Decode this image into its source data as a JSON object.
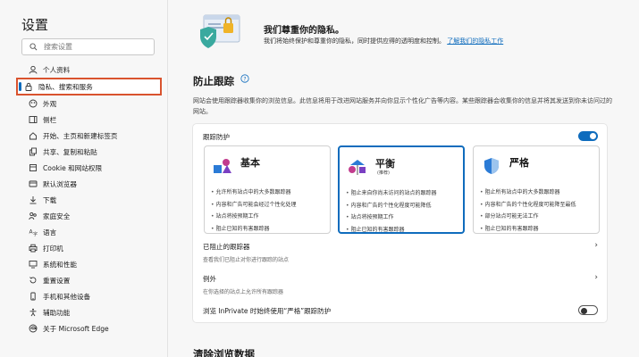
{
  "sidebar": {
    "title": "设置",
    "search_placeholder": "搜索设置",
    "items": [
      {
        "label": "个人资料",
        "icon": "profile-icon"
      },
      {
        "label": "隐私、搜索和服务",
        "icon": "lock-icon",
        "active": true
      },
      {
        "label": "外观",
        "icon": "appearance-icon"
      },
      {
        "label": "侧栏",
        "icon": "sidebar-icon"
      },
      {
        "label": "开始、主页和新建标签页",
        "icon": "home-icon"
      },
      {
        "label": "共享、复制和粘贴",
        "icon": "share-icon"
      },
      {
        "label": "Cookie 和网站权限",
        "icon": "cookie-icon"
      },
      {
        "label": "默认浏览器",
        "icon": "browser-icon"
      },
      {
        "label": "下载",
        "icon": "download-icon"
      },
      {
        "label": "家庭安全",
        "icon": "family-icon"
      },
      {
        "label": "语言",
        "icon": "language-icon"
      },
      {
        "label": "打印机",
        "icon": "printer-icon"
      },
      {
        "label": "系统和性能",
        "icon": "system-icon"
      },
      {
        "label": "重置设置",
        "icon": "reset-icon"
      },
      {
        "label": "手机和其他设备",
        "icon": "phone-icon"
      },
      {
        "label": "辅助功能",
        "icon": "accessibility-icon"
      },
      {
        "label": "关于 Microsoft Edge",
        "icon": "edge-icon"
      }
    ]
  },
  "banner": {
    "title": "我们尊重你的隐私。",
    "desc": "我们将始终保护和尊重你的隐私，同时提供应得的透明度和控制。",
    "link": "了解我们的隐私工作"
  },
  "tracking": {
    "title": "防止跟踪",
    "desc": "网站会使用跟踪器收集你的浏览信息。此信息将用于改进网站服务并向你显示个性化广告等内容。某些跟踪器会收集你的信息并将其发送到你未访问过的网站。",
    "toggle_label": "跟踪防护",
    "toggle_on": true,
    "levels": [
      {
        "name": "基本",
        "sub": "",
        "selected": false,
        "bullets": [
          "允许所有站点中的大多数跟踪器",
          "内容和广告可能会经过个性化处理",
          "站点将按预期工作",
          "阻止已知的有害跟踪器"
        ]
      },
      {
        "name": "平衡",
        "sub": "(推荐)",
        "selected": true,
        "bullets": [
          "阻止来自你尚未访问的站点的跟踪器",
          "内容和广告的个性化程度可能降低",
          "站点将按预期工作",
          "阻止已知的有害跟踪器"
        ]
      },
      {
        "name": "严格",
        "sub": "",
        "selected": false,
        "bullets": [
          "阻止所有站点中的大多数跟踪器",
          "内容和广告的个性化程度可能降至最低",
          "部分站点可能无法工作",
          "阻止已知的有害跟踪器"
        ]
      }
    ],
    "blocked_title": "已阻止的跟踪器",
    "blocked_sub": "查看我们已阻止对你进行跟踪的站点",
    "exceptions_title": "例外",
    "exceptions_sub": "在你选择的站点上允许所有跟踪器",
    "inprivate_label": "浏览 InPrivate 时始终使用“严格”跟踪防护",
    "inprivate_on": false
  },
  "next_section_title": "清除浏览数据",
  "colors": {
    "accent": "#0f6cbd",
    "highlight_box": "#d9532e"
  }
}
